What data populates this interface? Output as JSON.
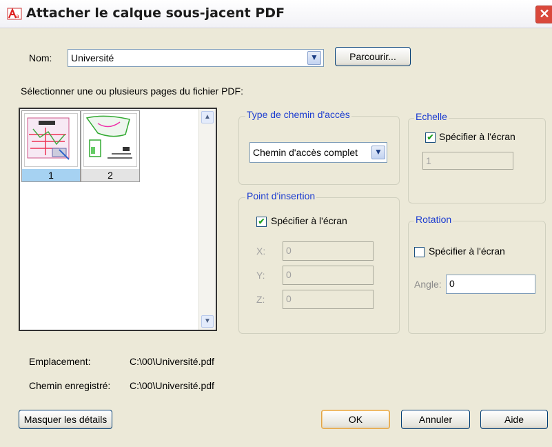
{
  "window": {
    "title": "Attacher le calque sous-jacent PDF",
    "close_icon": "close-icon"
  },
  "name_row": {
    "label": "Nom:",
    "value": "Université",
    "browse_label": "Parcourir..."
  },
  "pages": {
    "label": "Sélectionner une ou plusieurs pages du fichier PDF:",
    "items": [
      {
        "number": "1",
        "selected": true
      },
      {
        "number": "2",
        "selected": false
      }
    ]
  },
  "path_type": {
    "title": "Type de chemin d'accès",
    "value": "Chemin d'accès complet"
  },
  "scale": {
    "title": "Echelle",
    "checkbox_label": "Spécifier à l'écran",
    "checked": true,
    "value": "1"
  },
  "insertion": {
    "title": "Point d'insertion",
    "checkbox_label": "Spécifier à l'écran",
    "checked": true,
    "x_label": "X:",
    "x_value": "0",
    "y_label": "Y:",
    "y_value": "0",
    "z_label": "Z:",
    "z_value": "0"
  },
  "rotation": {
    "title": "Rotation",
    "checkbox_label": "Spécifier à l'écran",
    "checked": false,
    "angle_label": "Angle:",
    "angle_value": "0"
  },
  "details": {
    "location_label": "Emplacement:",
    "location_value": "C:\\00\\Université.pdf",
    "saved_path_label": "Chemin enregistré:",
    "saved_path_value": "C:\\00\\Université.pdf"
  },
  "buttons": {
    "hide_details": "Masquer les détails",
    "ok": "OK",
    "cancel": "Annuler",
    "help": "Aide"
  },
  "colors": {
    "group_title": "#1a3bd0",
    "selected_page": "#a6d2f2",
    "check": "#21a121"
  }
}
